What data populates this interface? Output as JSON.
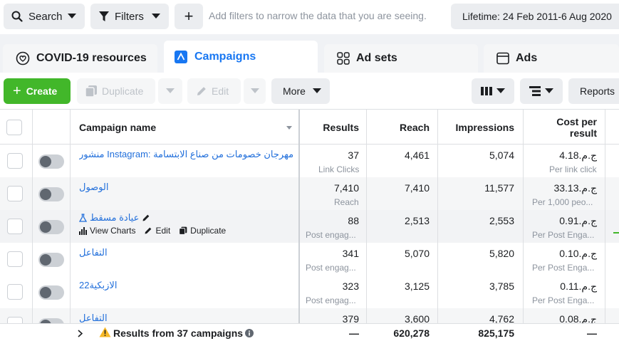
{
  "topbar": {
    "search_label": "Search",
    "filters_label": "Filters",
    "add_label": "+",
    "filter_hint": "Add filters to narrow the data that you are seeing.",
    "lifetime_label": "Lifetime: 24 Feb 2011-6 Aug 2020"
  },
  "tabs": [
    {
      "label": "COVID-19 resources",
      "icon": "heart-hands-icon"
    },
    {
      "label": "Campaigns",
      "icon": "campaign-icon",
      "active": true
    },
    {
      "label": "Ad sets",
      "icon": "grid-icon"
    },
    {
      "label": "Ads",
      "icon": "ad-icon"
    }
  ],
  "toolbar": {
    "create_label": "Create",
    "duplicate_label": "Duplicate",
    "edit_label": "Edit",
    "more_label": "More",
    "reports_label": "Reports"
  },
  "table": {
    "headers": {
      "name": "Campaign name",
      "results": "Results",
      "reach": "Reach",
      "impressions": "Impressions",
      "cost": "Cost per result"
    },
    "row_actions": {
      "view_charts": "View Charts",
      "edit": "Edit",
      "duplicate": "Duplicate"
    },
    "rows": [
      {
        "name": "منشور Instagram: مهرجان خصومات من صناع الابتسامة...",
        "results": "37",
        "results_sub": "Link Clicks",
        "reach": "4,461",
        "impressions": "5,074",
        "cost": "ج.م.4.18",
        "cost_sub": "Per link click"
      },
      {
        "name": "الوصول",
        "results": "7,410",
        "results_sub": "Reach",
        "reach": "7,410",
        "impressions": "11,577",
        "cost": "ج.م.33.13",
        "cost_sub": "Per 1,000 peo..."
      },
      {
        "name": "عيادة مسقط",
        "results": "88",
        "results_sub": "Post engag...",
        "reach": "2,513",
        "impressions": "2,553",
        "cost": "ج.م.0.91",
        "cost_sub": "Per Post Enga...",
        "hovered": true
      },
      {
        "name": "التفاعل",
        "results": "341",
        "results_sub": "Post engag...",
        "reach": "5,070",
        "impressions": "5,820",
        "cost": "ج.م.0.10",
        "cost_sub": "Per Post Enga..."
      },
      {
        "name": "الازبكية22",
        "results": "323",
        "results_sub": "Post engag...",
        "reach": "3,125",
        "impressions": "3,785",
        "cost": "ج.م.0.11",
        "cost_sub": "Per Post Enga..."
      },
      {
        "name": "التفاعل",
        "results": "379",
        "results_sub": "",
        "reach": "3,600",
        "impressions": "4,762",
        "cost": "ج.م.0.08",
        "cost_sub": ""
      }
    ],
    "footer": {
      "label": "Results from 37 campaigns",
      "results": "—",
      "reach": "620,278",
      "impressions": "825,175",
      "cost": "—"
    }
  },
  "colors": {
    "accent": "#1877f2",
    "create": "#42b72a",
    "link": "#216fdb"
  }
}
